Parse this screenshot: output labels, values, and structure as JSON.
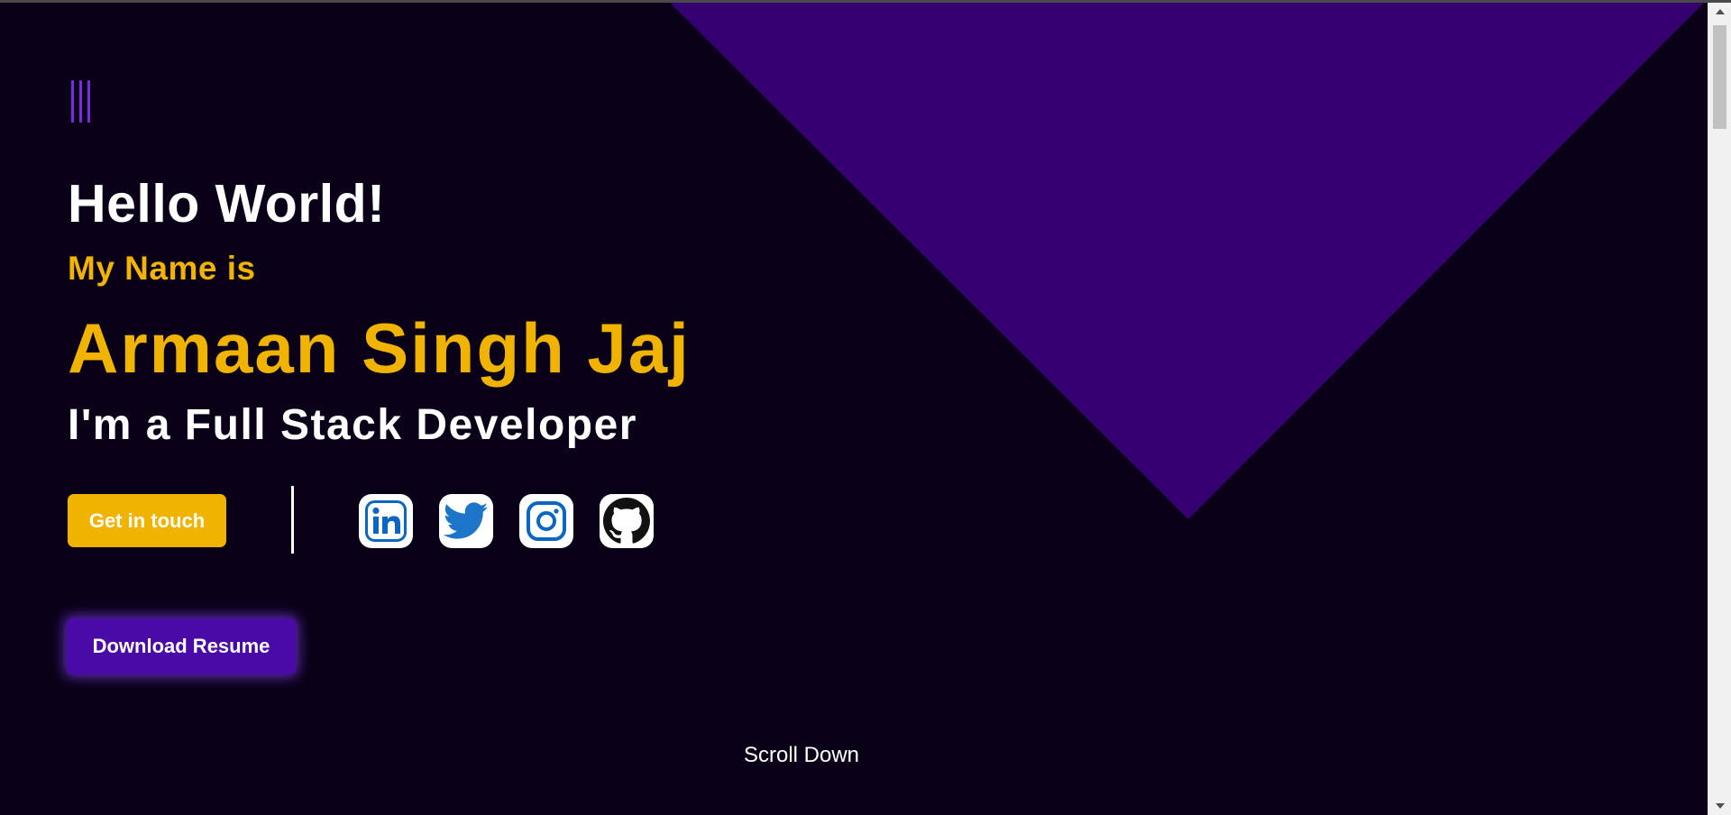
{
  "colors": {
    "background": "#0a0118",
    "triangle": "#350070",
    "accent_yellow": "#f0b400",
    "menu_purple": "#7b2be2",
    "resume_purple": "#4a0aa8",
    "icon_blue": "#0a66c2",
    "icon_twitter": "#1d75c9",
    "icon_black": "#111111"
  },
  "hero": {
    "greeting": "Hello World!",
    "intro": "My Name is",
    "name": "Armaan Singh Jaj",
    "role": "I'm a Full Stack Developer"
  },
  "actions": {
    "get_in_touch_label": "Get in touch",
    "download_resume_label": "Download Resume"
  },
  "social_links": [
    {
      "icon": "linkedin-icon"
    },
    {
      "icon": "twitter-icon"
    },
    {
      "icon": "instagram-icon"
    },
    {
      "icon": "github-icon"
    }
  ],
  "footer": {
    "scroll_label": "Scroll Down"
  },
  "menu": {
    "icon": "hamburger-menu-icon"
  }
}
